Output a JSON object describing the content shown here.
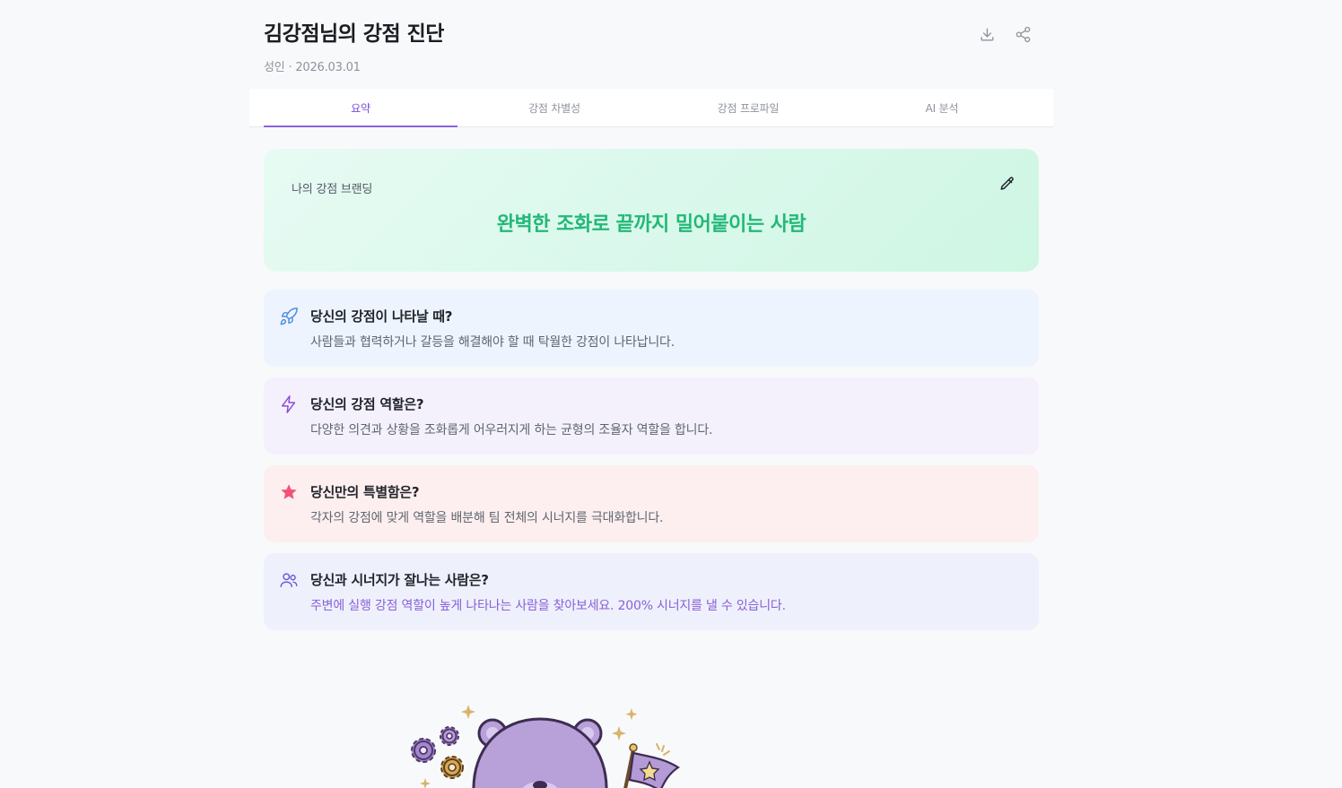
{
  "header": {
    "title": "김강점님의 강점 진단",
    "meta": "성인 · 2026.03.01"
  },
  "tabs": [
    {
      "label": "요약",
      "active": true
    },
    {
      "label": "강점 차별성",
      "active": false
    },
    {
      "label": "강점 프로파일",
      "active": false
    },
    {
      "label": "AI 분석",
      "active": false
    }
  ],
  "branding": {
    "label": "나의 강점 브랜딩",
    "text": "완벽한 조화로 끝까지 밀어붙이는 사람"
  },
  "cards": [
    {
      "icon": "rocket-icon",
      "question": "당신의 강점이 나타날 때?",
      "answer": "사람들과 협력하거나 갈등을 해결해야 할 때 탁월한 강점이 나타납니다.",
      "accent": "#4a8de0"
    },
    {
      "icon": "lightning-icon",
      "question": "당신의 강점 역할은?",
      "answer": "다양한 의견과 상황을 조화롭게 어우러지게 하는 균형의 조율자 역할을 합니다.",
      "accent": "#8a4ed8"
    },
    {
      "icon": "star-icon",
      "question": "당신만의 특별함은?",
      "answer": "각자의 강점에 맞게 역할을 배분해 팀 전체의 시너지를 극대화합니다.",
      "accent": "#f0527a"
    },
    {
      "icon": "users-icon",
      "question": "당신과 시너지가 잘나는 사람은?",
      "answer": "주변에 실행 강점 역할이 높게 나타나는 사람을 찾아보세요. 200% 시너지를 낼 수 있습니다.",
      "accent": "#6b5bdc"
    }
  ],
  "colors": {
    "brand_text": "#23b877",
    "tab_active": "#7b4dd8"
  }
}
